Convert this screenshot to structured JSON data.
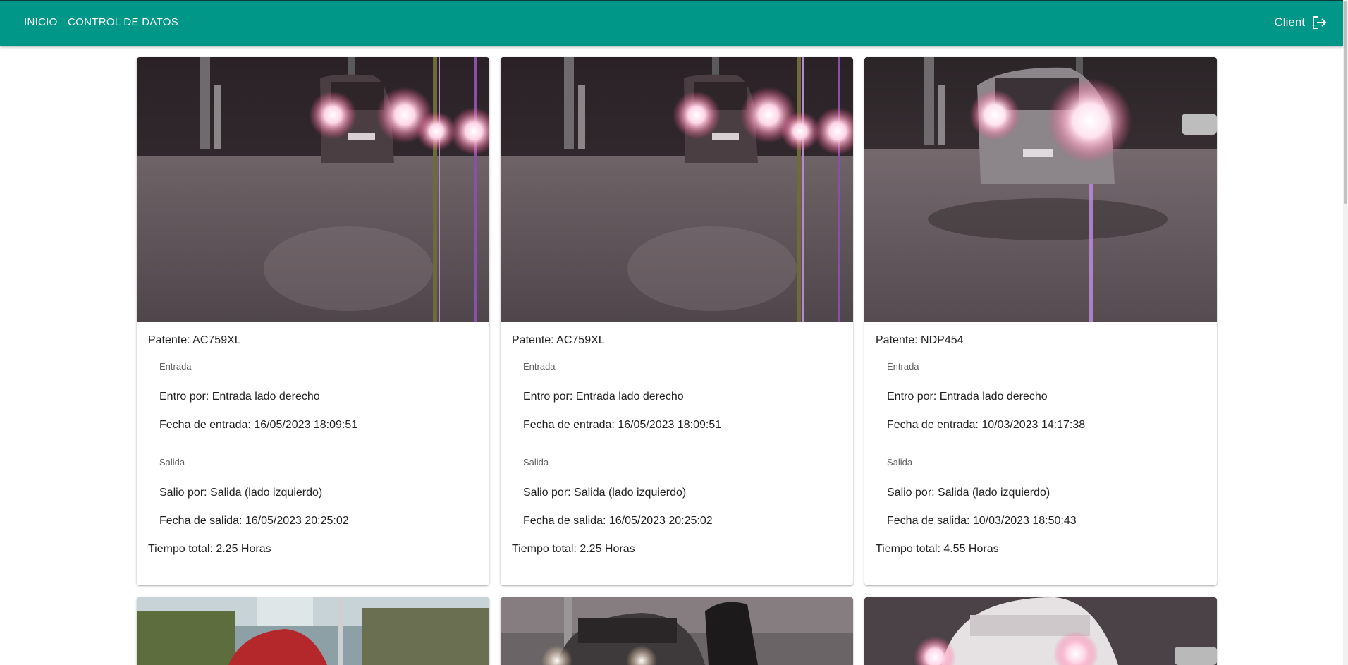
{
  "nav": {
    "inicio": "INICIO",
    "control": "CONTROL DE DATOS",
    "user": "Client"
  },
  "colors": {
    "appbar": "#009688"
  },
  "cards": [
    {
      "patente": "Patente: AC759XL",
      "entrada_title": "Entrada",
      "entro_por": "Entro por: Entrada lado derecho",
      "fecha_entrada": "Fecha de entrada: 16/05/2023 18:09:51",
      "salida_title": "Salida",
      "salio_por": "Salio por: Salida (lado izquierdo)",
      "fecha_salida": "Fecha de salida: 16/05/2023 20:25:02",
      "tiempo_total": "Tiempo total: 2.25 Horas"
    },
    {
      "patente": "Patente: AC759XL",
      "entrada_title": "Entrada",
      "entro_por": "Entro por: Entrada lado derecho",
      "fecha_entrada": "Fecha de entrada: 16/05/2023 18:09:51",
      "salida_title": "Salida",
      "salio_por": "Salio por: Salida (lado izquierdo)",
      "fecha_salida": "Fecha de salida: 16/05/2023 20:25:02",
      "tiempo_total": "Tiempo total: 2.25 Horas"
    },
    {
      "patente": "Patente: NDP454",
      "entrada_title": "Entrada",
      "entro_por": "Entro por: Entrada lado derecho",
      "fecha_entrada": "Fecha de entrada: 10/03/2023 14:17:38",
      "salida_title": "Salida",
      "salio_por": "Salio por: Salida (lado izquierdo)",
      "fecha_salida": "Fecha de salida: 10/03/2023 18:50:43",
      "tiempo_total": "Tiempo total: 4.55 Horas"
    }
  ]
}
